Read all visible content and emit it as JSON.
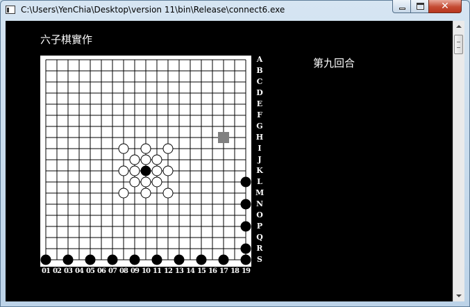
{
  "window": {
    "title": "C:\\Users\\YenChia\\Desktop\\version 11\\bin\\Release\\connect6.exe",
    "close_glyph": "✕"
  },
  "console": {
    "app_title": "六子棋實作",
    "round_text": "第九回合"
  },
  "board": {
    "size": 19,
    "row_labels": [
      "A",
      "B",
      "C",
      "D",
      "E",
      "F",
      "G",
      "H",
      "I",
      "J",
      "K",
      "L",
      "M",
      "N",
      "O",
      "P",
      "Q",
      "R",
      "S"
    ],
    "col_labels": [
      "01",
      "02",
      "03",
      "04",
      "05",
      "06",
      "07",
      "08",
      "09",
      "10",
      "11",
      "12",
      "13",
      "14",
      "15",
      "16",
      "17",
      "18",
      "19"
    ],
    "colors": {
      "board": "#ffffff",
      "grid": "#000000",
      "black_stone": "#000000",
      "white_stone": "#ffffff",
      "cursor": "#808080"
    },
    "white_stones": [
      [
        7,
        8
      ],
      [
        9,
        8
      ],
      [
        11,
        8
      ],
      [
        8,
        9
      ],
      [
        9,
        9
      ],
      [
        10,
        9
      ],
      [
        7,
        10
      ],
      [
        8,
        10
      ],
      [
        10,
        10
      ],
      [
        11,
        10
      ],
      [
        8,
        11
      ],
      [
        9,
        11
      ],
      [
        10,
        11
      ],
      [
        7,
        12
      ],
      [
        9,
        12
      ],
      [
        11,
        12
      ]
    ],
    "black_stones": [
      [
        9,
        10
      ],
      [
        18,
        11
      ],
      [
        18,
        13
      ],
      [
        18,
        15
      ],
      [
        18,
        17
      ],
      [
        0,
        18
      ],
      [
        2,
        18
      ],
      [
        4,
        18
      ],
      [
        6,
        18
      ],
      [
        8,
        18
      ],
      [
        10,
        18
      ],
      [
        12,
        18
      ],
      [
        14,
        18
      ],
      [
        16,
        18
      ],
      [
        18,
        18
      ]
    ],
    "cursor": [
      16,
      7
    ]
  }
}
